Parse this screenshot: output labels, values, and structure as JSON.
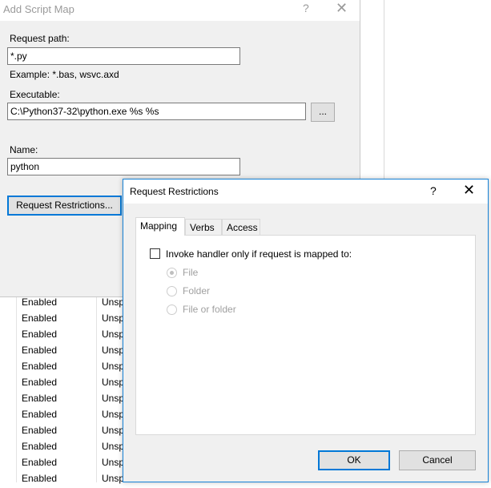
{
  "background": {
    "edge_glyphs": [
      "d",
      "d",
      "d",
      "d",
      "d",
      "d",
      "d",
      "d",
      "d",
      "d",
      "d"
    ],
    "rows": [
      {
        "status": "Enabled",
        "type": "Unsp"
      },
      {
        "status": "Enabled",
        "type": "Unsp"
      },
      {
        "status": "Enabled",
        "type": "Unsp"
      },
      {
        "status": "Enabled",
        "type": "Unsp"
      },
      {
        "status": "Enabled",
        "type": "Unsp"
      },
      {
        "status": "Enabled",
        "type": "Unsp"
      },
      {
        "status": "Enabled",
        "type": "Unsp"
      },
      {
        "status": "Enabled",
        "type": "Unsp"
      },
      {
        "status": "Enabled",
        "type": "Unsp"
      },
      {
        "status": "Enabled",
        "type": "Unsp"
      },
      {
        "status": "Enabled",
        "type": "Unsp"
      },
      {
        "status": "Enabled",
        "type": "Unsp"
      }
    ]
  },
  "add_script_map": {
    "title": "Add Script Map",
    "help_glyph": "?",
    "close_glyph": "✕",
    "request_path_label": "Request path:",
    "request_path_value": "*.py",
    "example_text": "Example: *.bas, wsvc.axd",
    "executable_label": "Executable:",
    "executable_value": "C:\\Python37-32\\python.exe %s %s",
    "browse_label": "...",
    "name_label": "Name:",
    "name_value": "python",
    "restrictions_button": "Request Restrictions..."
  },
  "request_restrictions": {
    "title": "Request Restrictions",
    "help_glyph": "?",
    "close_glyph": "✕",
    "tabs": [
      "Mapping",
      "Verbs",
      "Access"
    ],
    "active_tab": "Mapping",
    "invoke_label": "Invoke handler only if request is mapped to:",
    "invoke_checked": false,
    "options": [
      "File",
      "Folder",
      "File or folder"
    ],
    "selected_option": "File",
    "ok_label": "OK",
    "cancel_label": "Cancel"
  },
  "colors": {
    "accent": "#0078d7",
    "dialog_bg": "#f0f0f0",
    "disabled_text": "#a0a0a0"
  }
}
